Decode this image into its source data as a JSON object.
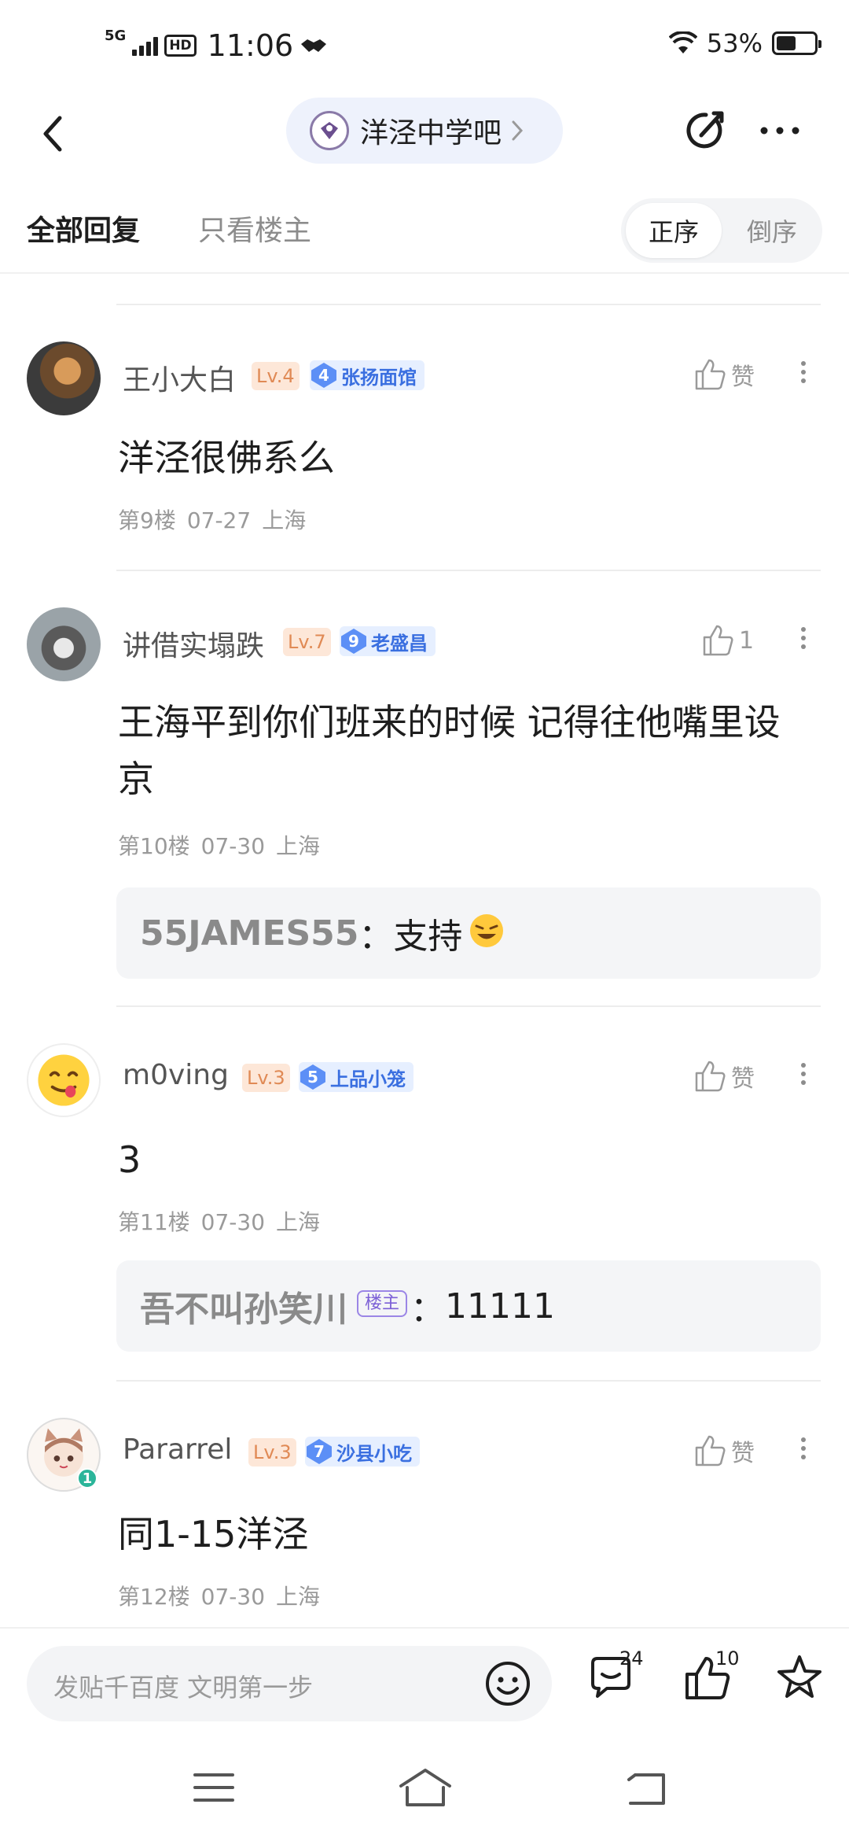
{
  "status_bar": {
    "network": "5G",
    "hd": "HD",
    "time": "11:06",
    "battery_pct": "53%",
    "battery_level": 0.53
  },
  "nav": {
    "bar_name": "洋泾中学吧"
  },
  "filters": {
    "all_replies": "全部回复",
    "only_op": "只看楼主",
    "order_asc": "正序",
    "order_desc": "倒序"
  },
  "posts": [
    {
      "username": "王小大白",
      "level": "Lv.4",
      "badge_num": "4",
      "badge_name": "张扬面馆",
      "like_label": "赞",
      "content": "洋泾很佛系么",
      "floor": "第9楼",
      "date": "07-27",
      "location": "上海"
    },
    {
      "username": "讲借实塌跌",
      "level": "Lv.7",
      "badge_num": "9",
      "badge_name": "老盛昌",
      "like_label": "1",
      "content": "王海平到你们班来的时候 记得往他嘴里设京",
      "floor": "第10楼",
      "date": "07-30",
      "location": "上海",
      "reply": {
        "user": "55JAMES55",
        "sep": "：",
        "text": "支持"
      }
    },
    {
      "username": "m0ving",
      "level": "Lv.3",
      "badge_num": "5",
      "badge_name": "上品小笼",
      "like_label": "赞",
      "content": "3",
      "floor": "第11楼",
      "date": "07-30",
      "location": "上海",
      "reply": {
        "user": "吾不叫孙笑川",
        "tag": "楼主",
        "sep": "：",
        "text": "11111"
      }
    },
    {
      "username": "Pararrel",
      "level": "Lv.3",
      "badge_num": "7",
      "badge_name": "沙县小吃",
      "like_label": "赞",
      "content": "同1-15洋泾",
      "floor": "第12楼",
      "date": "07-30",
      "location": "上海",
      "avatar_badge": "1"
    }
  ],
  "bottom_bar": {
    "input_placeholder": "发贴千百度 文明第一步",
    "comment_count": "24",
    "like_count": "10"
  },
  "colors": {
    "accent_blue": "#5c8ff6",
    "level_bg": "#fde7d8",
    "level_text": "#e08a55"
  }
}
